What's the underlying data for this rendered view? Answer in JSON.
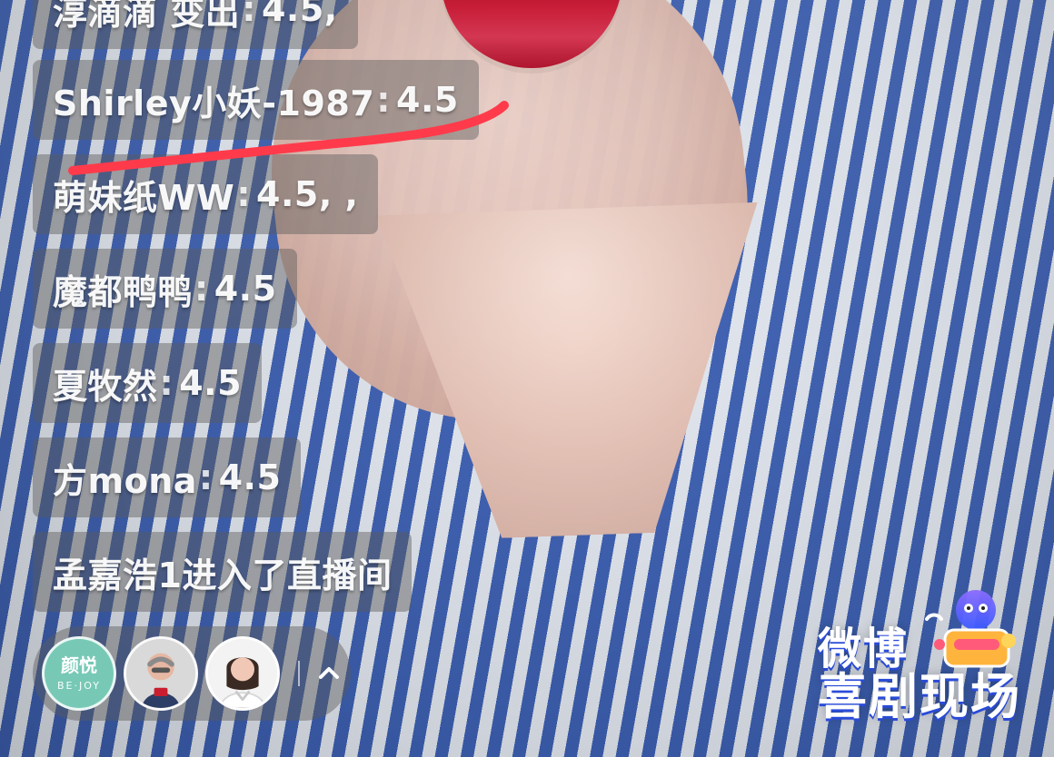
{
  "comments": [
    {
      "user": "淳滴滴 变出",
      "text": "4.5,"
    },
    {
      "user": "Shirley小妖-1987",
      "text": "4.5"
    },
    {
      "user": "萌妹纸WW",
      "text": "4.5, ,"
    },
    {
      "user": "魔都鸭鸭",
      "text": "4.5"
    },
    {
      "user": "夏牧然",
      "text": "4.5"
    },
    {
      "user": "方mona",
      "text": "4.5"
    }
  ],
  "system_message": "孟嘉浩1进入了直播间",
  "separator": ":",
  "bottom": {
    "brand_avatar": {
      "title": "颜悦",
      "subtitle": "BE·JOY"
    },
    "expand_icon": "chevron-up-icon"
  },
  "watermark": {
    "line1": "微博",
    "line2": "喜剧现场"
  },
  "colors": {
    "comment_bg": "rgba(90,90,90,0.45)",
    "annotation_red": "#ff3b4b",
    "watermark_blue": "#2a4bd8",
    "brand_avatar": "#77c9b6"
  }
}
